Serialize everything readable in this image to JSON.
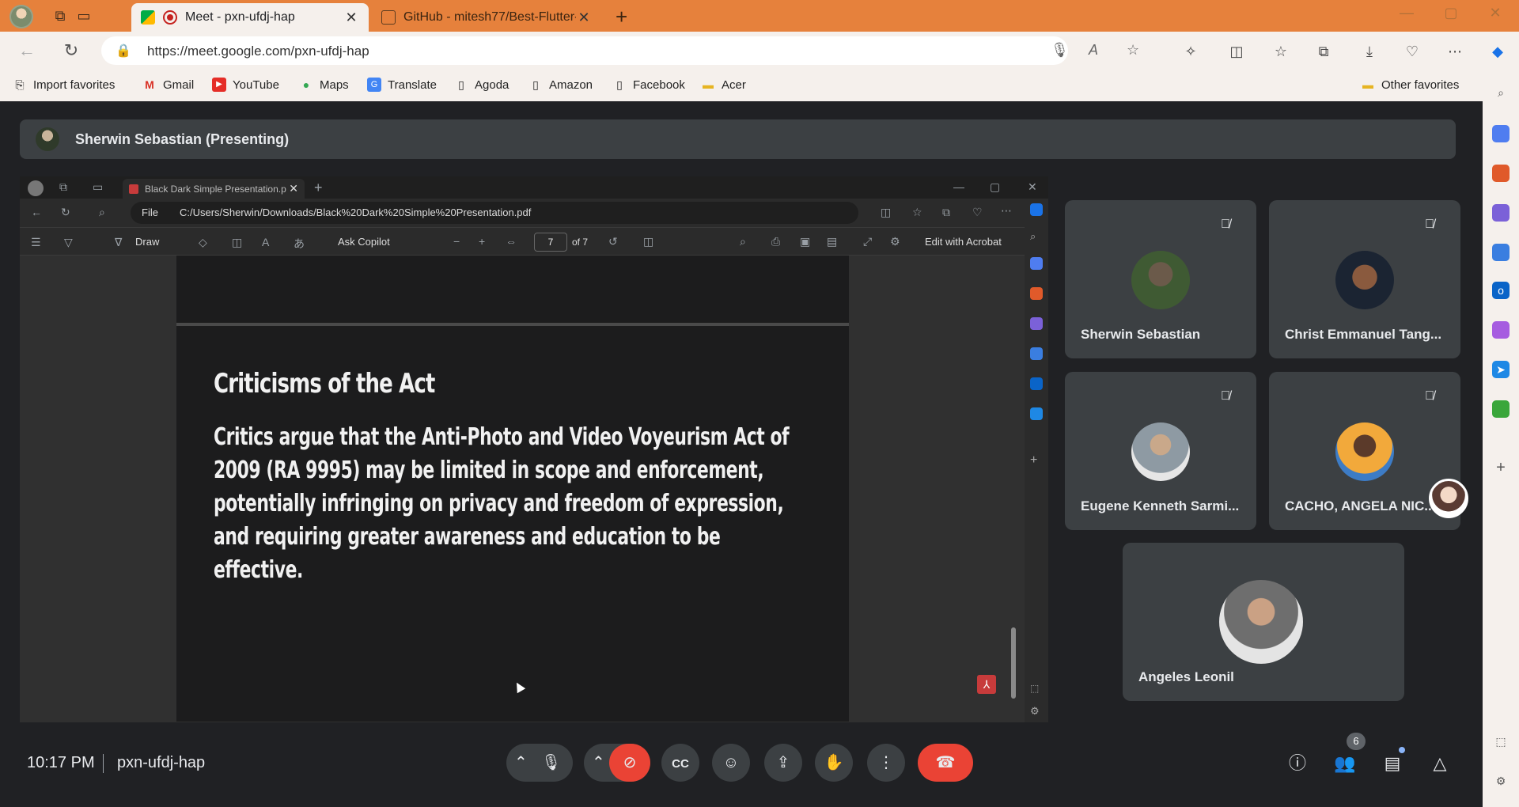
{
  "browser": {
    "tabs": [
      {
        "title": "Meet - pxn-ufdj-hap",
        "active": true
      },
      {
        "title": "GitHub - mitesh77/Best-Flutter-U",
        "active": false
      }
    ],
    "url": "https://meet.google.com/pxn-ufdj-hap",
    "favorites": [
      "Import favorites",
      "Gmail",
      "YouTube",
      "Maps",
      "Translate",
      "Agoda",
      "Amazon",
      "Facebook",
      "Acer"
    ],
    "other_favorites": "Other favorites"
  },
  "meet": {
    "presenter_label": "Sherwin Sebastian (Presenting)",
    "time": "10:17 PM",
    "meeting_code": "pxn-ufdj-hap",
    "participant_count": "6",
    "participants": [
      {
        "name": "Sherwin Sebastian",
        "muted": true
      },
      {
        "name": "Christ Emmanuel Tang...",
        "muted": true
      },
      {
        "name": "Eugene Kenneth Sarmi...",
        "muted": true
      },
      {
        "name": "CACHO, ANGELA NIC...",
        "muted": true
      },
      {
        "name": "Angeles Leonil",
        "muted": false
      }
    ]
  },
  "shared_screen": {
    "tab_title": "Black Dark Simple Presentation.p",
    "file_label": "File",
    "path": "C:/Users/Sherwin/Downloads/Black%20Dark%20Simple%20Presentation.pdf",
    "draw_label": "Draw",
    "ask_copilot": "Ask Copilot",
    "page_current": "7",
    "page_total": "of 7",
    "edit_acrobat": "Edit with Acrobat",
    "slide": {
      "title": "Criticisms of the Act",
      "body": "Critics argue that the Anti-Photo and Video Voyeurism Act of 2009 (RA 9995) may be limited in scope and enforcement, potentially infringing on privacy and freedom of expression, and requiring greater awareness and education to be effective."
    }
  },
  "colors": {
    "tabstrip": "#e6813c",
    "meet_bg": "#202124",
    "tile_bg": "#3c4043",
    "end_call": "#ea4335"
  }
}
